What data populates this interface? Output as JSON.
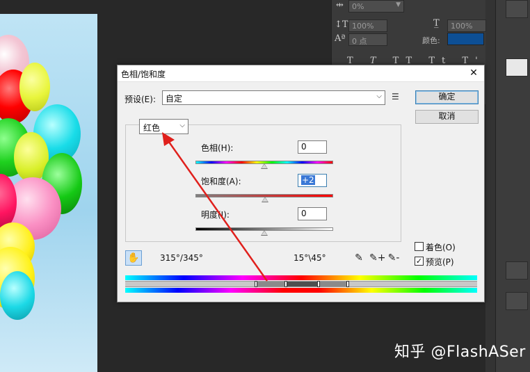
{
  "dialog": {
    "title": "色相/饱和度",
    "close_label": "✕",
    "preset_label": "预设(E):",
    "preset_value": "自定",
    "ok_label": "确定",
    "cancel_label": "取消",
    "channel_value": "红色",
    "hue_label": "色相(H):",
    "hue_value": "0",
    "saturation_label": "饱和度(A):",
    "saturation_value": "+2",
    "lightness_label": "明度(I):",
    "lightness_value": "0",
    "range_left": "315°/345°",
    "range_right": "15°\\45°",
    "colorize_label": "着色(O)",
    "preview_label": "预览(P)",
    "preview_checked": "✓"
  },
  "right_panel": {
    "tracking_value": "0%",
    "vscale_value": "100%",
    "hscale_value": "100%",
    "baseline_value": "0 点",
    "color_label": "颜色:",
    "color_value": "#0d4f95",
    "type_buttons": [
      "T",
      "T",
      "TT",
      "Tt",
      "T'",
      "T,",
      "T",
      "T"
    ]
  },
  "icons": {
    "hand": "✋",
    "dropper": "✎",
    "dropper_plus": "✎+",
    "dropper_minus": "✎-",
    "preset_menu": "☰"
  },
  "annotation": {
    "color": "#e0201c"
  },
  "watermark": "知乎 @FlashASer"
}
